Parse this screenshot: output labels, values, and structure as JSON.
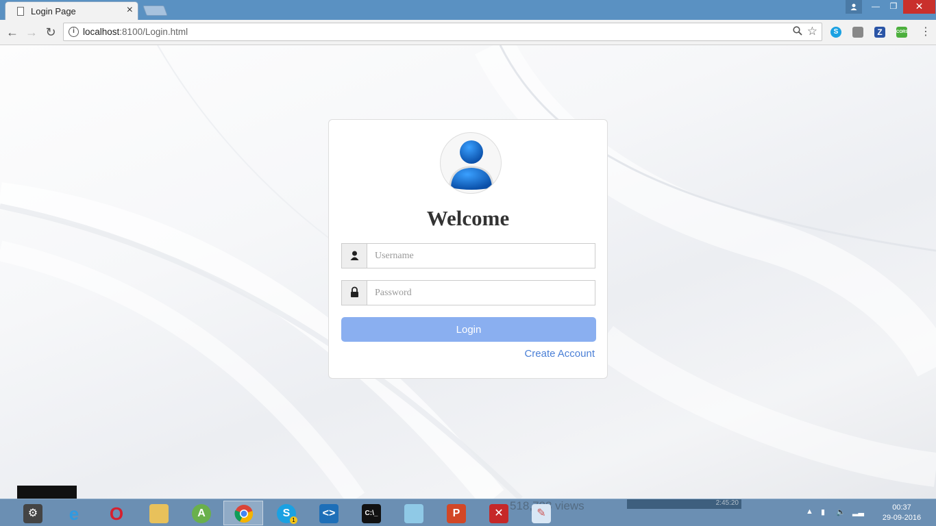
{
  "browser": {
    "tab_title": "Login Page",
    "tab_close": "×",
    "url_host": "localhost",
    "url_rest": ":8100/Login.html",
    "window_controls": {
      "minimize": "—",
      "maximize": "❐",
      "close": "✕"
    },
    "extensions": [
      "skype-icon",
      "pocket-icon",
      "zotero-icon",
      "cors-icon"
    ],
    "extension_labels": {
      "zotero": "Z",
      "cors": "CORS"
    }
  },
  "page": {
    "heading": "Welcome",
    "username_placeholder": "Username",
    "password_placeholder": "Password",
    "login_label": "Login",
    "create_account_label": "Create Account"
  },
  "taskbar": {
    "apps": [
      "ie-icon",
      "opera-icon",
      "file-explorer-icon",
      "android-studio-icon",
      "chrome-icon",
      "skype-icon",
      "visual-studio-code-icon",
      "cmd-icon",
      "app-icon",
      "powerpoint-icon",
      "app-icon",
      "paint-icon"
    ],
    "active_app": "chrome",
    "skype_badge": "1",
    "background_text": "518,788 views",
    "background_time": "2:45:20",
    "clock_time": "00:37",
    "clock_date": "29-09-2016"
  },
  "colors": {
    "titlebar": "#5a91c2",
    "login_button": "#8aaff0",
    "link": "#4a7fd6",
    "taskbar": "#6b8fb3"
  }
}
